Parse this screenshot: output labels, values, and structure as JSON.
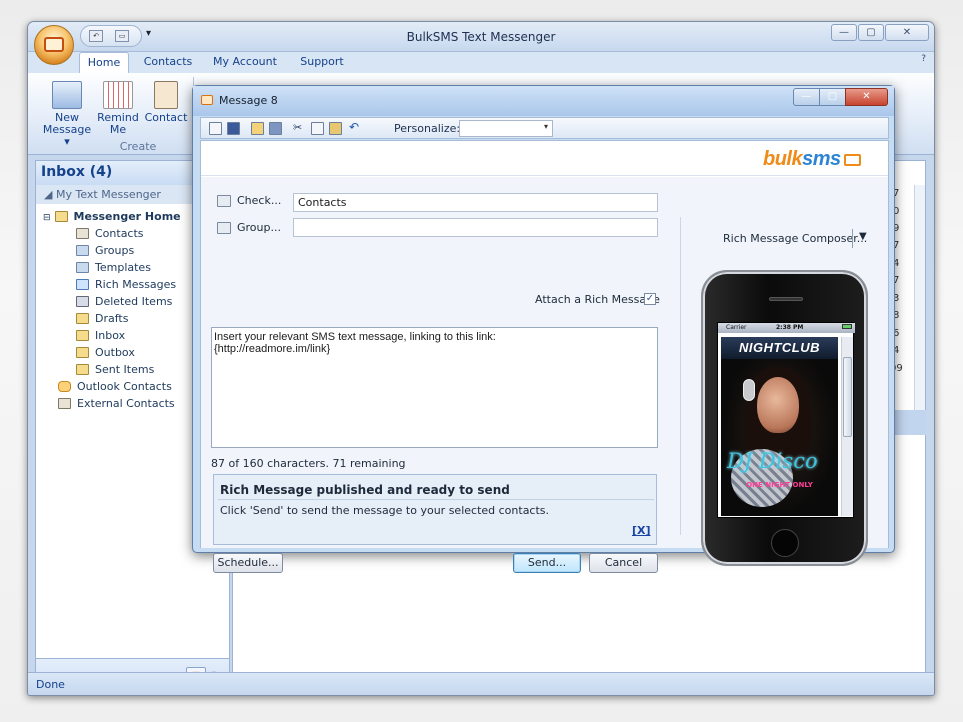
{
  "app": {
    "title": "BulkSMS Text Messenger",
    "tabs": [
      "Home",
      "Contacts",
      "My Account",
      "Support"
    ],
    "ribbon": {
      "new_message": "New\nMessage ▾",
      "remind_me": "Remind\nMe",
      "contact": "Contact",
      "group_label": "Create"
    },
    "nav": {
      "header": "Inbox (4)",
      "subheader": "My Text Messenger",
      "tree": {
        "root": "Messenger Home",
        "items": [
          "Contacts",
          "Groups",
          "Templates",
          "Rich Messages",
          "Deleted Items",
          "Drafts",
          "Inbox",
          "Outbox",
          "Sent Items"
        ],
        "outlook": "Outlook Contacts",
        "external": "External Contacts"
      }
    },
    "status": "Done",
    "side_numbers": [
      "7",
      "0",
      "9",
      "7",
      "4",
      "7",
      "3",
      "8",
      "6",
      "4",
      "09"
    ]
  },
  "dialog": {
    "title": "Message 8",
    "toolbar": {
      "personalize_label": "Personalize:",
      "personalize_value": ""
    },
    "brand": {
      "part1": "bulk",
      "part2": "sms"
    },
    "form": {
      "check_button": "Check...",
      "check_value": "Contacts",
      "group_button": "Group...",
      "group_value": "",
      "attach_label": "Attach a Rich Message",
      "attach_checked": true,
      "message_text": "Insert your relevant SMS text message, linking to this link:\n{http://readmore.im/link}",
      "char_count": "87 of 160 characters. 71 remaining"
    },
    "notice": {
      "title": "Rich Message published and ready to send",
      "text": "Click 'Send' to send the message to your selected contacts.",
      "close": "[X]"
    },
    "buttons": {
      "schedule": "Schedule...",
      "send": "Send...",
      "cancel": "Cancel"
    },
    "composer": {
      "label": "Rich Message Composer...",
      "phone": {
        "carrier": "Carrier",
        "time": "2:38 PM",
        "flyer_title": "NIGHTCLUB",
        "flyer_dj": "DJ Disco",
        "flyer_sub": "ONE NIGHT ONLY"
      }
    }
  },
  "colors": {
    "accent": "#15428b",
    "brand_orange": "#ee8b19",
    "brand_blue": "#2c84d3"
  }
}
